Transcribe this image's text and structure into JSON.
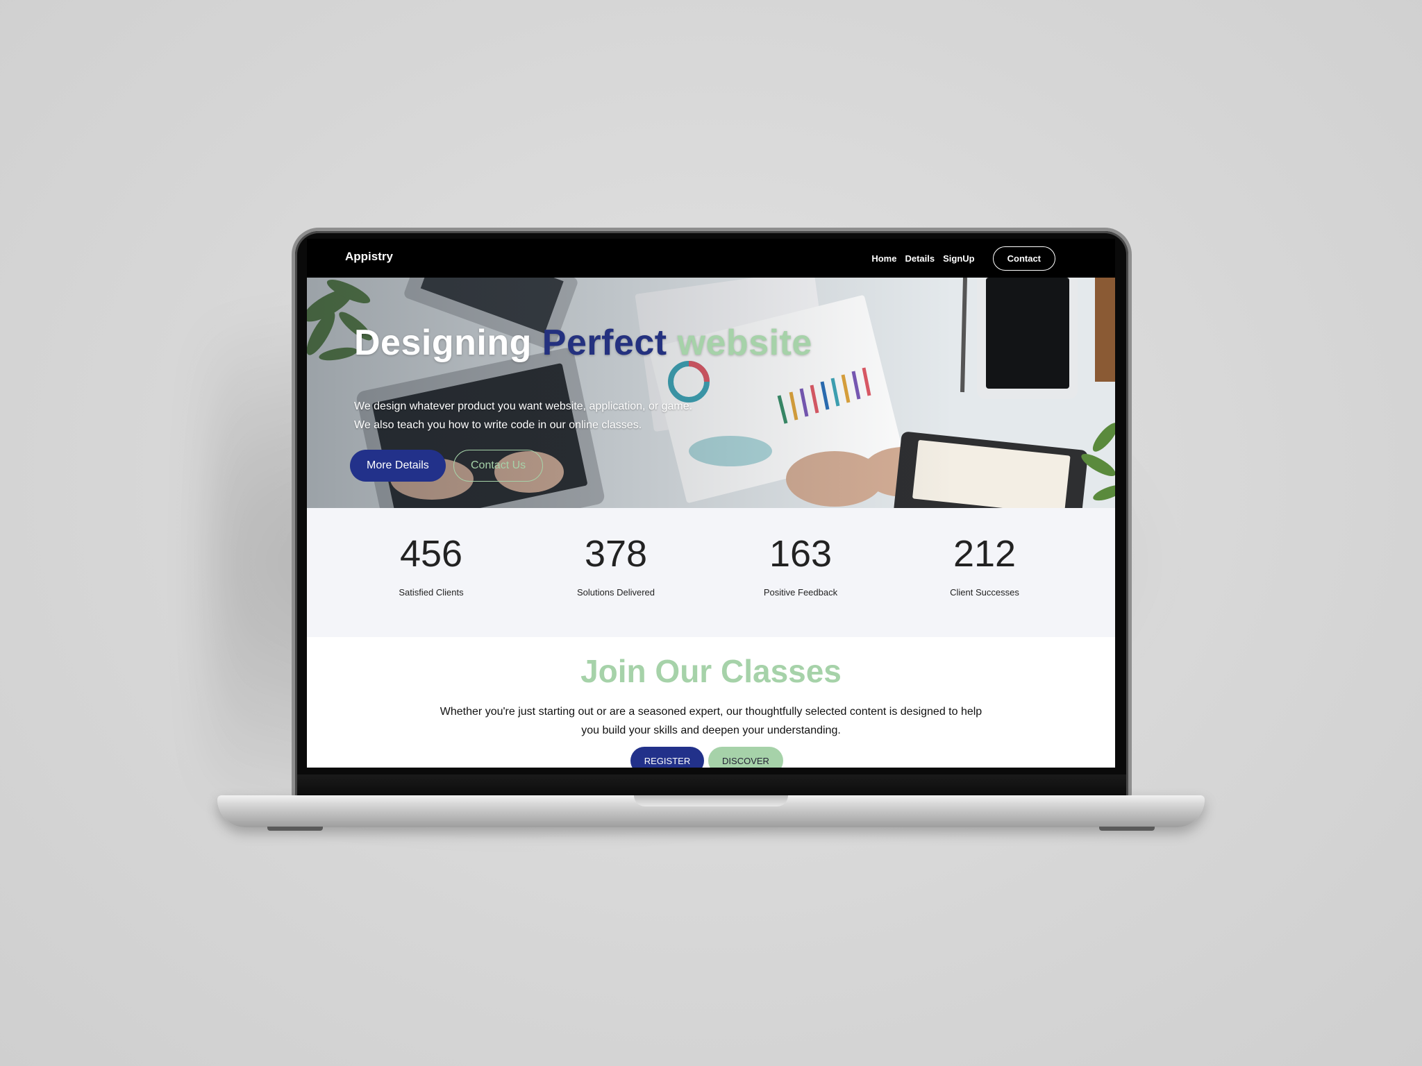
{
  "nav": {
    "brand": "Appistry",
    "links": [
      "Home",
      "Details",
      "SignUp"
    ],
    "contact_label": "Contact"
  },
  "hero": {
    "title_part1": "Designing ",
    "title_part2": "Perfect ",
    "title_part3": "website",
    "description": "We design whatever product you want website, application, or game. We also teach you how to write code in our online classes.",
    "primary_button": "More Details",
    "secondary_button": "Contact Us"
  },
  "stats": [
    {
      "value": "456",
      "label": "Satisfied Clients"
    },
    {
      "value": "378",
      "label": "Solutions Delivered"
    },
    {
      "value": "163",
      "label": "Positive Feedback"
    },
    {
      "value": "212",
      "label": "Client Successes"
    }
  ],
  "classes": {
    "title": "Join Our Classes",
    "description": "Whether you're just starting out or are a seasoned expert, our thoughtfully selected content is designed to help you build your skills and deepen your understanding.",
    "register_label": "REGISTER",
    "discover_label": "DISCOVER"
  },
  "colors": {
    "navy": "#22318a",
    "mint": "#a6d2a9",
    "stats_bg": "#f4f5f9",
    "nav_bg": "#000000"
  }
}
